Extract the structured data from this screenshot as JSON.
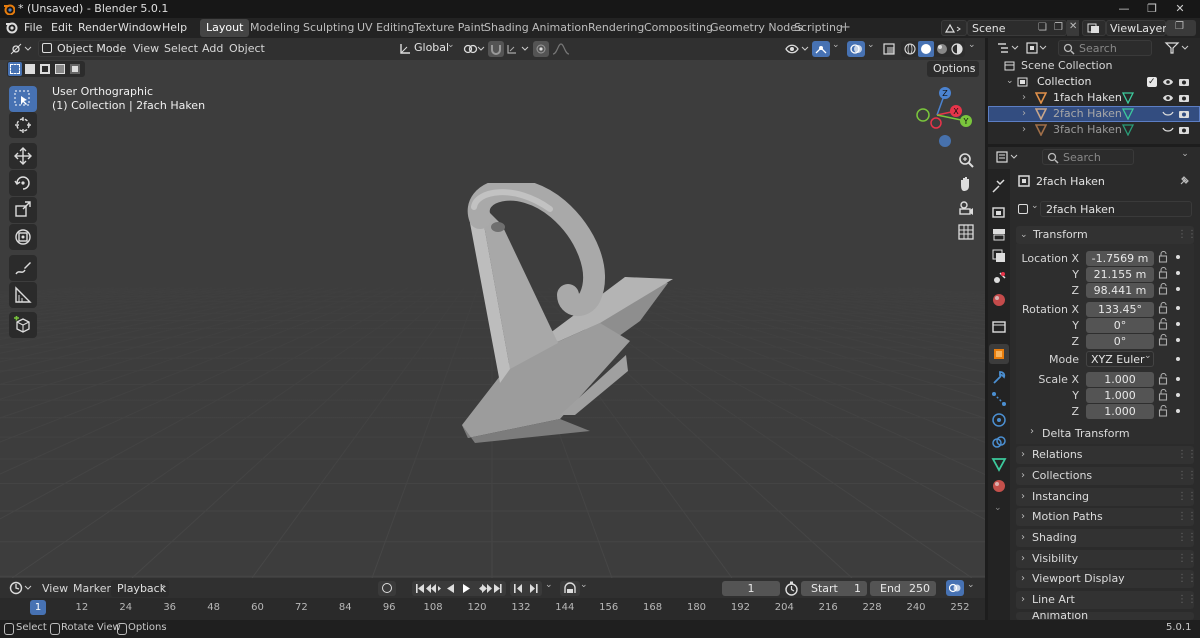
{
  "window": {
    "title": "* (Unsaved) - Blender 5.0.1",
    "controls": [
      "minimize",
      "maximize",
      "close"
    ]
  },
  "menubar": {
    "items": [
      "File",
      "Edit",
      "Render",
      "Window",
      "Help"
    ],
    "workspaces": [
      "Layout",
      "Modeling",
      "Sculpting",
      "UV Editing",
      "Texture Paint",
      "Shading",
      "Animation",
      "Rendering",
      "Compositing",
      "Geometry Nodes",
      "Scripting"
    ],
    "active_workspace": "Layout",
    "add_workspace": "+",
    "scene": "Scene",
    "view_layer": "ViewLayer"
  },
  "viewport": {
    "mode": "Object Mode",
    "menus": [
      "View",
      "Select",
      "Add",
      "Object"
    ],
    "orientation": "Global",
    "options_label": "Options",
    "view_name": "User Orthographic",
    "object_info": "(1) Collection | 2fach Haken",
    "gizmo_axes": [
      "Z",
      "X",
      "Y"
    ],
    "colors": {
      "background": "#3d3d3d",
      "grid": "#454545",
      "model": "#a6a6a6",
      "x_axis": "#e8344a",
      "y_axis": "#7ac63c",
      "z_axis": "#4b83d1",
      "active_tool": "#4772b3"
    }
  },
  "tools": [
    {
      "icon": "select-box-icon",
      "active": true
    },
    {
      "icon": "cursor-icon",
      "active": false
    },
    {
      "icon": "move-icon",
      "active": false
    },
    {
      "icon": "rotate-icon",
      "active": false
    },
    {
      "icon": "scale-icon",
      "active": false
    },
    {
      "icon": "transform-icon",
      "active": false
    },
    {
      "icon": "annotate-icon",
      "active": false
    },
    {
      "icon": "measure-icon",
      "active": false
    },
    {
      "icon": "add-cube-icon",
      "active": false
    }
  ],
  "outliner": {
    "search_placeholder": "Search",
    "root": "Scene Collection",
    "collection": "Collection",
    "objects": [
      {
        "name": "1fach Haken",
        "selected": false,
        "visible": true
      },
      {
        "name": "2fach Haken",
        "selected": true,
        "visible": false
      },
      {
        "name": "3fach Haken",
        "selected": false,
        "visible": false
      }
    ]
  },
  "properties": {
    "search_placeholder": "Search",
    "object_name": "2fach Haken",
    "datablock_name": "2fach Haken",
    "transform_label": "Transform",
    "location_label": "Location X",
    "location": [
      "-1.7569 m",
      "21.155 m",
      "98.441 m"
    ],
    "rotation_label": "Rotation X",
    "rotation": [
      "133.45°",
      "0°",
      "0°"
    ],
    "mode_label": "Mode",
    "rotation_mode": "XYZ Euler",
    "scale_label": "Scale X",
    "scale": [
      "1.000",
      "1.000",
      "1.000"
    ],
    "axis_y": "Y",
    "axis_z": "Z",
    "delta_transform": "Delta Transform",
    "panels": [
      "Relations",
      "Collections",
      "Instancing",
      "Motion Paths",
      "Shading",
      "Visibility",
      "Viewport Display",
      "Line Art",
      "Animation"
    ]
  },
  "timeline": {
    "menus": [
      "View",
      "Marker"
    ],
    "playback": "Playback",
    "current_frame": "1",
    "start_label": "Start",
    "start": "1",
    "end_label": "End",
    "end": "250",
    "ticks": [
      "1",
      "12",
      "24",
      "36",
      "48",
      "60",
      "72",
      "84",
      "96",
      "108",
      "120",
      "132",
      "144",
      "156",
      "168",
      "180",
      "192",
      "204",
      "216",
      "228",
      "240",
      "252"
    ],
    "current_tick": "1"
  },
  "statusbar": {
    "hints": [
      "Select",
      "Rotate View",
      "Options"
    ],
    "version": "5.0.1"
  }
}
